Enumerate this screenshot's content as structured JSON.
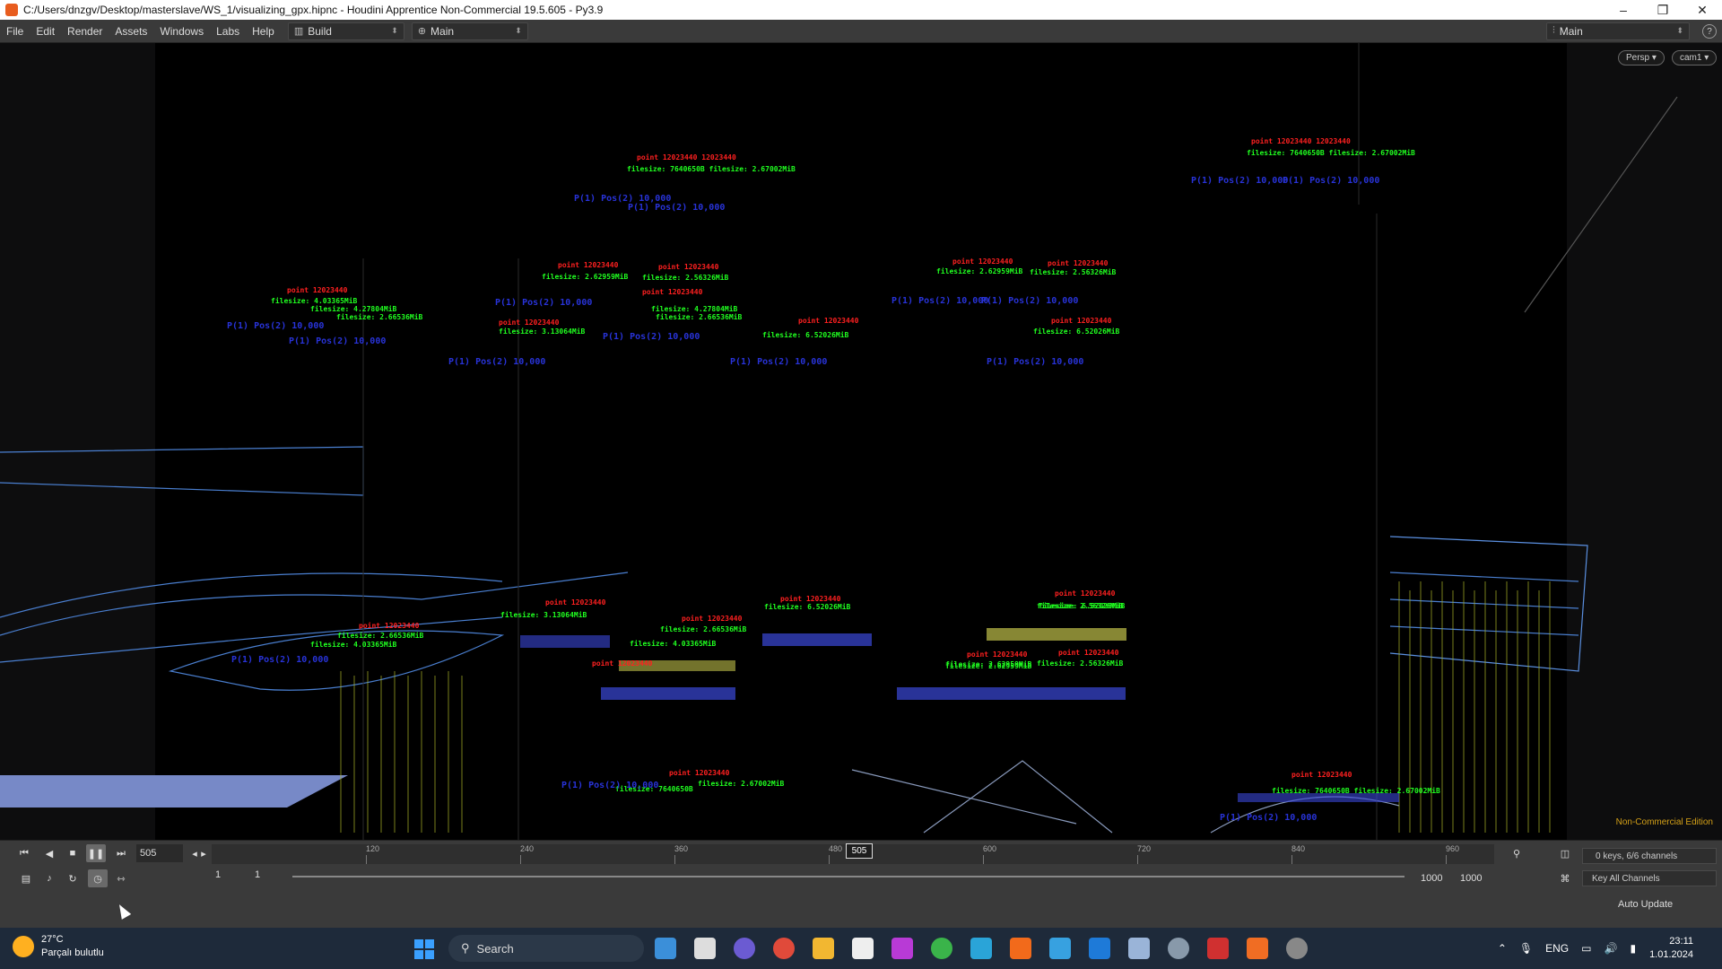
{
  "window": {
    "title": "C:/Users/dnzgv/Desktop/masterslave/WS_1/visualizing_gpx.hipnc - Houdini Apprentice Non-Commercial 19.5.605 - Py3.9",
    "minimize": "–",
    "maximize": "❐",
    "close": "✕"
  },
  "menubar": {
    "items": [
      "File",
      "Edit",
      "Render",
      "Assets",
      "Windows",
      "Labs",
      "Help"
    ],
    "desktop_build": "Build",
    "desktop_main": "Main",
    "right_desktop": "Main",
    "help": "?"
  },
  "viewport": {
    "persp_button": "Persp ▾",
    "camera_button": "cam1 ▾",
    "non_commercial": "Non-Commercial Edition",
    "green_labels": [
      "filesize: 7640650B  filesize: 2.67002MiB",
      "filesize: 7640650B  filesize: 2.67002MiB",
      "filesize: 4.03365MiB",
      "filesize: 4.27804MiB",
      "filesize: 2.66536MiB",
      "filesize: 2.62959MiB",
      "filesize: 2.56326MiB",
      "filesize: 4.27804MiB",
      "filesize: 2.66536MiB",
      "filesize: 3.13064MiB",
      "filesize: 6.52026MiB",
      "filesize: 2.62959MiB",
      "filesize: 2.56326MiB",
      "filesize: 6.52026MiB",
      "filesize: 6.52026MiB",
      "filesize: 3.13064MiB",
      "filesize: 2.66536MiB",
      "filesize: 4.03365MiB",
      "filesize: 2.56326MiB",
      "filesize: 2.62959MiB",
      "filesize: 4.03365MiB",
      "filesize: 2.66536MiB",
      "filesize: 6.52026MiB",
      "filesize: 2.62959MiB",
      "filesize: 2.56326MiB",
      "filesize: 7640650B",
      "filesize: 2.67002MiB",
      "filesize: 7640650B  filesize: 2.67002MiB"
    ]
  },
  "timeline": {
    "current_frame": "505",
    "ruler_labels": [
      "120",
      "240",
      "360",
      "480",
      "600",
      "720",
      "840",
      "960"
    ],
    "range_start": "1",
    "range_start2": "1",
    "range_end": "1000",
    "range_end2": "1000",
    "keys_info": "0 keys, 6/6 channels",
    "key_all": "Key All Channels",
    "auto_update": "Auto Update"
  },
  "taskbar": {
    "temperature": "27°C",
    "weather": "Parçalı bulutlu",
    "search": "Search",
    "language": "ENG",
    "time": "23:11",
    "date": "1.01.2024"
  }
}
